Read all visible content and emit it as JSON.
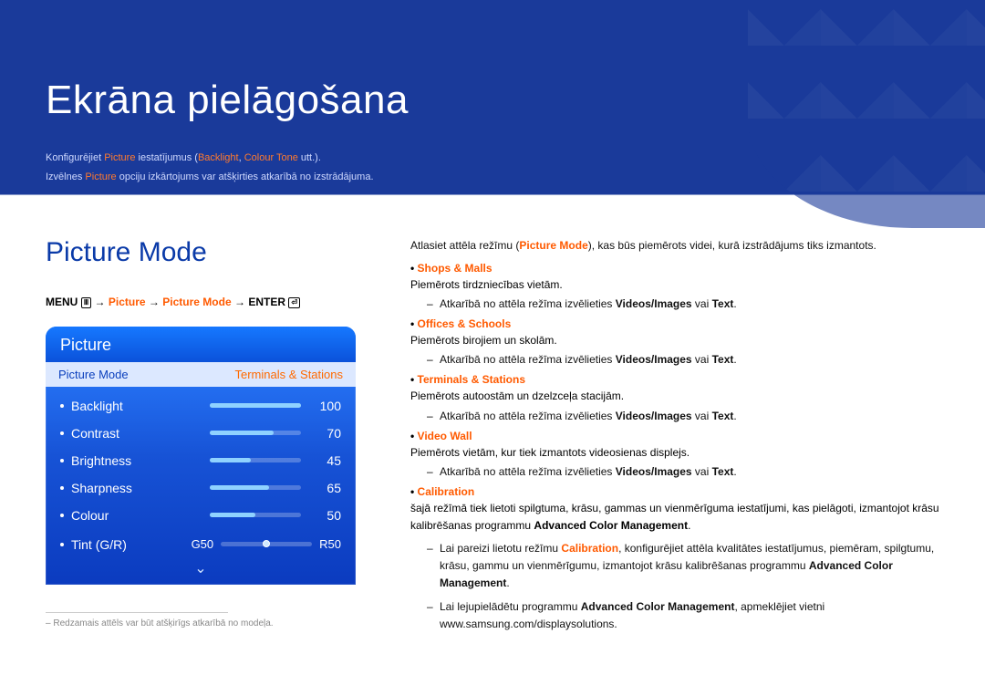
{
  "header": {
    "title": "Ekrāna pielāgošana",
    "intro_pre": "Konfigurējiet ",
    "intro_hl1": "Picture",
    "intro_mid1": " iestatījumus (",
    "intro_hl2": "Backlight",
    "intro_mid2": ", ",
    "intro_hl3": "Colour Tone",
    "intro_mid3": " utt.).",
    "intro2_pre": "Izvēlnes ",
    "intro2_hl": "Picture",
    "intro2_post": " opciju izkārtojums var atšķirties atkarībā no izstrādājuma."
  },
  "section_title": "Picture Mode",
  "menu_path": {
    "menu": "MENU",
    "arrow": "→",
    "seg1": "Picture",
    "seg2": "Picture Mode",
    "enter": "ENTER"
  },
  "osd": {
    "panel_title": "Picture",
    "row_label": "Picture Mode",
    "row_value": "Terminals & Stations",
    "items": [
      {
        "label": "Backlight",
        "value": "100",
        "pct": 100
      },
      {
        "label": "Contrast",
        "value": "70",
        "pct": 70
      },
      {
        "label": "Brightness",
        "value": "45",
        "pct": 45
      },
      {
        "label": "Sharpness",
        "value": "65",
        "pct": 65
      },
      {
        "label": "Colour",
        "value": "50",
        "pct": 50
      }
    ],
    "tint": {
      "label": "Tint (G/R)",
      "left": "G50",
      "right": "R50",
      "pos": 50
    },
    "more_glyph": "⌄"
  },
  "footnote": "Redzamais attēls var būt atšķirīgs atkarībā no modeļa.",
  "right": {
    "lead_pre": "Atlasiet attēla režīmu (",
    "lead_hl": "Picture Mode",
    "lead_post": "), kas būs piemērots videi, kurā izstrādājums tiks izmantots.",
    "modes": [
      {
        "title": "Shops & Malls",
        "desc": "Piemērots tirdzniecības vietām.",
        "sub_pre": "Atkarībā no attēla režīma izvēlieties ",
        "sub_b1": "Videos/Images",
        "sub_mid": " vai ",
        "sub_b2": "Text",
        "sub_end": "."
      },
      {
        "title": "Offices & Schools",
        "desc": "Piemērots birojiem un skolām.",
        "sub_pre": "Atkarībā no attēla režīma izvēlieties ",
        "sub_b1": "Videos/Images",
        "sub_mid": " vai ",
        "sub_b2": "Text",
        "sub_end": "."
      },
      {
        "title": "Terminals & Stations",
        "desc": "Piemērots autoostām un dzelzceļa stacijām.",
        "sub_pre": "Atkarībā no attēla režīma izvēlieties ",
        "sub_b1": "Videos/Images",
        "sub_mid": " vai ",
        "sub_b2": "Text",
        "sub_end": "."
      },
      {
        "title": "Video Wall",
        "desc": "Piemērots vietām, kur tiek izmantots videosienas displejs.",
        "sub_pre": "Atkarībā no attēla režīma izvēlieties ",
        "sub_b1": "Videos/Images",
        "sub_mid": " vai ",
        "sub_b2": "Text",
        "sub_end": "."
      }
    ],
    "calibration": {
      "title": "Calibration",
      "desc_pre": "šajā režīmā tiek lietoti spilgtuma, krāsu, gammas un vienmērīguma iestatījumi, kas pielāgoti, izmantojot krāsu kalibrēšanas programmu ",
      "desc_b": "Advanced Color Management",
      "desc_end": ".",
      "sub1_pre": "Lai pareizi lietotu režīmu ",
      "sub1_hl": "Calibration",
      "sub1_mid": ", konfigurējiet attēla kvalitātes iestatījumus, piemēram, spilgtumu, krāsu, gammu un vienmērīgumu, izmantojot krāsu kalibrēšanas programmu ",
      "sub1_b": "Advanced Color Management",
      "sub1_end": ".",
      "sub2_pre": "Lai lejupielādētu programmu ",
      "sub2_b": "Advanced Color Management",
      "sub2_mid": ", apmeklējiet vietni www.samsung.com/displaysolutions."
    }
  }
}
